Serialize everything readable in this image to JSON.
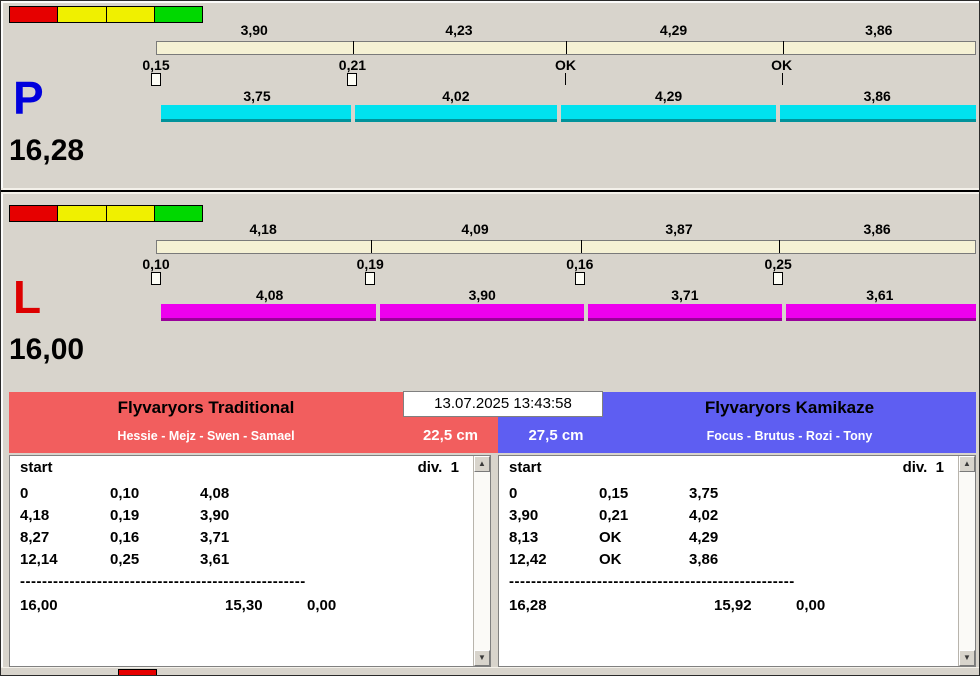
{
  "icons": {
    "scroll_up": "▲",
    "scroll_down": "▼"
  },
  "lanes": [
    {
      "id": "P",
      "letter": "P",
      "letter_color": "#0000dd",
      "total": "16,28",
      "bar_color": "#00e2ef",
      "indicator_colors": [
        "#e60000",
        "#f0f000",
        "#f0f000",
        "#00d800"
      ],
      "segments": [
        {
          "top": "3,90",
          "mid": "0,15",
          "marker": "square",
          "bottom": "3,75"
        },
        {
          "top": "4,23",
          "mid": "0,21",
          "marker": "square",
          "bottom": "4,02"
        },
        {
          "top": "4,29",
          "mid": "OK",
          "marker": "tick",
          "bottom": "4,29"
        },
        {
          "top": "3,86",
          "mid": "OK",
          "marker": "tick",
          "bottom": "3,86"
        }
      ]
    },
    {
      "id": "L",
      "letter": "L",
      "letter_color": "#dd0000",
      "total": "16,00",
      "bar_color": "#ee00ee",
      "indicator_colors": [
        "#e60000",
        "#f0f000",
        "#f0f000",
        "#00d800"
      ],
      "segments": [
        {
          "top": "4,18",
          "mid": "0,10",
          "marker": "square",
          "bottom": "4,08"
        },
        {
          "top": "4,09",
          "mid": "0,19",
          "marker": "square",
          "bottom": "3,90"
        },
        {
          "top": "3,87",
          "mid": "0,16",
          "marker": "square",
          "bottom": "3,71"
        },
        {
          "top": "3,86",
          "mid": "0,25",
          "marker": "square",
          "bottom": "3,61"
        }
      ]
    }
  ],
  "teams": {
    "datetime": "13.07.2025 13:43:58",
    "left": {
      "name": "Flyvaryors Traditional",
      "members": "Hessie - Mejz - Swen - Samael",
      "distance": "22,5 cm",
      "color": "#f25e5e"
    },
    "right": {
      "name": "Flyvaryors Kamikaze",
      "members": "Focus - Brutus - Rozi - Tony",
      "distance": "27,5 cm",
      "color": "#5e5ef2"
    }
  },
  "results": {
    "panels": [
      {
        "header_start": "start",
        "header_div": "div.  1",
        "rows": [
          [
            "0",
            "0,10",
            "4,08"
          ],
          [
            "4,18",
            "0,19",
            "3,90"
          ],
          [
            "8,27",
            "0,16",
            "3,71"
          ],
          [
            "12,14",
            "0,25",
            "3,61"
          ]
        ],
        "divider": "----------------------------------------------------",
        "total": [
          "16,00",
          "15,30",
          "0,00"
        ]
      },
      {
        "header_start": "start",
        "header_div": "div.  1",
        "rows": [
          [
            "0",
            "0,15",
            "3,75"
          ],
          [
            "3,90",
            "0,21",
            "4,02"
          ],
          [
            "8,13",
            "OK",
            "4,29"
          ],
          [
            "12,42",
            "OK",
            "3,86"
          ]
        ],
        "divider": "----------------------------------------------------",
        "total": [
          "16,28",
          "15,92",
          "0,00"
        ]
      }
    ]
  }
}
